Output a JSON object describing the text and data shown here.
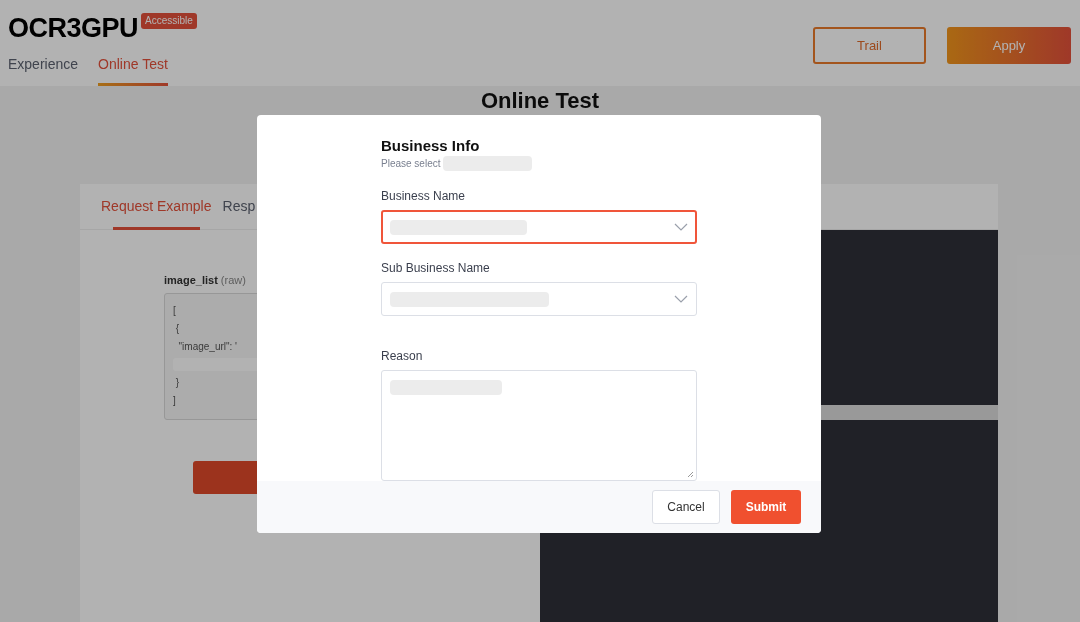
{
  "header": {
    "logo": "OCR3GPU",
    "badge": "Accessible",
    "nav": [
      {
        "label": "Experience",
        "selected": false
      },
      {
        "label": "Online Test",
        "selected": true
      }
    ],
    "buttons": [
      {
        "label": "Trail",
        "kind": "outline"
      },
      {
        "label": "Apply",
        "kind": "filled"
      }
    ]
  },
  "page_title": "Online Test",
  "card": {
    "tabs": [
      {
        "label": "Request Example",
        "selected": true
      },
      {
        "label": "Resp",
        "selected": false
      }
    ],
    "param": {
      "name": "image_list",
      "type": "(raw)"
    },
    "code_lines": [
      {
        "kind": "text",
        "text": "["
      },
      {
        "kind": "text",
        "text": " {"
      },
      {
        "kind": "text",
        "text": "  \"image_url\": '"
      },
      {
        "kind": "redacted"
      },
      {
        "kind": "text",
        "text": " }"
      },
      {
        "kind": "text",
        "text": "]"
      }
    ]
  },
  "modal": {
    "title": "Business Info",
    "subtitle": "Please select",
    "fields": [
      {
        "label": "Business Name",
        "kind": "select",
        "focused": true
      },
      {
        "label": "Sub Business Name",
        "kind": "select",
        "focused": false
      },
      {
        "label": "Reason",
        "kind": "textarea",
        "focused": false
      }
    ],
    "buttons": [
      {
        "label": "Cancel",
        "kind": "secondary"
      },
      {
        "label": "Submit",
        "kind": "primary"
      }
    ]
  }
}
